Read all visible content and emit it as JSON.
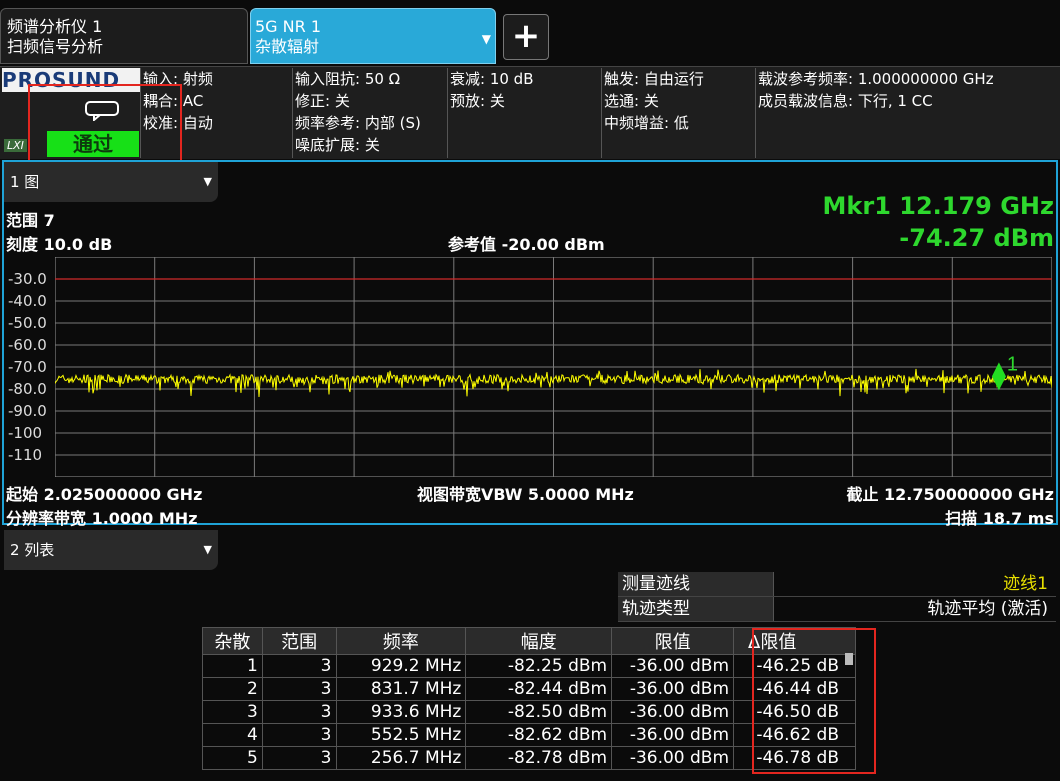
{
  "tabs": [
    {
      "line1": "频谱分析仪 1",
      "line2": "扫频信号分析"
    },
    {
      "line1": "5G NR 1",
      "line2": "杂散辐射",
      "dropdown_icon": "dropdown-arrow"
    }
  ],
  "add_tab": "+",
  "brand": "PROSUND",
  "lxi": "LXI",
  "status": {
    "pass_text": "通过",
    "pass_color": "#17e017"
  },
  "info": {
    "col1": [
      "输入: 射频",
      "耦合: AC",
      "校准: 自动"
    ],
    "col2": [
      "输入阻抗: 50 Ω",
      "修正: 关",
      "频率参考: 内部 (S)",
      "噪底扩展: 关"
    ],
    "col3": [
      "衰减: 10 dB",
      "预放: 关"
    ],
    "col4": [
      "触发: 自由运行",
      "选通: 关",
      "中频增益: 低"
    ],
    "col5": [
      "载波参考频率: 1.000000000 GHz",
      "成员载波信息: 下行, 1 CC"
    ]
  },
  "graph": {
    "window_label": "1 图",
    "range": "范围 7",
    "scale": "刻度 10.0 dB",
    "ref": "参考值 -20.00 dBm",
    "marker_freq": "Mkr1  12.179 GHz",
    "marker_amp": "-74.27 dBm",
    "marker_label": "1",
    "start": "起始 2.025000000 GHz",
    "rbw": "分辨率带宽 1.0000 MHz",
    "vbw": "视图带宽VBW 5.0000 MHz",
    "stop": "截止 12.750000000 GHz",
    "sweep": "扫描 18.7 ms",
    "y_ticks": [
      "-30.0",
      "-40.0",
      "-50.0",
      "-60.0",
      "-70.0",
      "-80.0",
      "-90.0",
      "-100",
      "-110"
    ],
    "ref_level_dbm": -20,
    "db_per_div": 10,
    "limit_line_dbm": -30,
    "trace_color": "#ffff00",
    "trace_mean_dbm": -75.5,
    "trace_spread_db": 4
  },
  "list": {
    "window_label": "2 列表",
    "meta": [
      {
        "key": "测量迹线",
        "value": "迹线1"
      },
      {
        "key": "轨迹类型",
        "value": "轨迹平均 (激活)"
      }
    ],
    "headers": [
      "杂散",
      "范围",
      "频率",
      "幅度",
      "限值",
      "Δ限值"
    ],
    "rows": [
      [
        "1",
        "3",
        "929.2 MHz",
        "-82.25 dBm",
        "-36.00 dBm",
        "-46.25 dB"
      ],
      [
        "2",
        "3",
        "831.7 MHz",
        "-82.44 dBm",
        "-36.00 dBm",
        "-46.44 dB"
      ],
      [
        "3",
        "3",
        "933.6 MHz",
        "-82.50 dBm",
        "-36.00 dBm",
        "-46.50 dB"
      ],
      [
        "4",
        "3",
        "552.5 MHz",
        "-82.62 dBm",
        "-36.00 dBm",
        "-46.62 dB"
      ],
      [
        "5",
        "3",
        "256.7 MHz",
        "-82.78 dBm",
        "-36.00 dBm",
        "-46.78 dB"
      ]
    ]
  }
}
